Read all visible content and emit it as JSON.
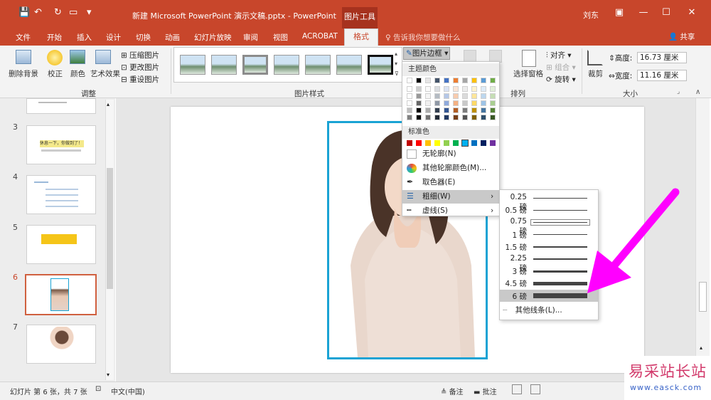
{
  "titlebar": {
    "doc_title": "新建 Microsoft PowerPoint 演示文稿.pptx - PowerPoint",
    "context_tab": "图片工具",
    "user": "刘东"
  },
  "tabs": [
    "文件",
    "开始",
    "插入",
    "设计",
    "切换",
    "动画",
    "幻灯片放映",
    "审阅",
    "视图",
    "ACROBAT",
    "格式"
  ],
  "tell_me": "告诉我你想要做什么",
  "share": "共享",
  "ribbon": {
    "remove_bg": "删除背景",
    "corrections": "校正",
    "color": "颜色",
    "artistic": "艺术效果",
    "compress": "压缩图片",
    "change": "更改图片",
    "reset": "重设图片",
    "group_adjust": "调整",
    "group_styles": "图片样式",
    "picture_border": "图片边框",
    "align": "对齐",
    "group_combine": "组合",
    "rotate": "旋转",
    "selection_pane": "选择窗格",
    "group_arrange": "排列",
    "crop": "裁剪",
    "height_label": "高度:",
    "height_value": "16.73 厘米",
    "width_label": "宽度:",
    "width_value": "11.16 厘米",
    "group_size": "大小"
  },
  "slides": [
    {
      "num": "3",
      "text": "休息一下，你做到了！"
    },
    {
      "num": "4",
      "text": ""
    },
    {
      "num": "5",
      "text": ""
    },
    {
      "num": "6",
      "text": ""
    },
    {
      "num": "7",
      "text": ""
    }
  ],
  "border_menu": {
    "theme_colors": "主题颜色",
    "standard_colors": "标准色",
    "no_outline": "无轮廓(N)",
    "more_colors": "其他轮廓颜色(M)...",
    "eyedropper": "取色器(E)",
    "weight": "粗细(W)",
    "dashes": "虚线(S)"
  },
  "theme_swatch_columns": [
    "#ffffff",
    "#000000",
    "#e7e6e6",
    "#44546a",
    "#4472c4",
    "#ed7d31",
    "#a5a5a5",
    "#ffc000",
    "#5b9bd5",
    "#70ad47"
  ],
  "standard_swatches": [
    "#c00000",
    "#ff0000",
    "#ffc000",
    "#ffff00",
    "#92d050",
    "#00b050",
    "#00b0f0",
    "#0070c0",
    "#002060",
    "#7030a0"
  ],
  "weights": [
    {
      "label": "0.25 磅",
      "value": 0.25
    },
    {
      "label": "0.5 磅",
      "value": 0.5
    },
    {
      "label": "0.75 磅",
      "value": 0.75
    },
    {
      "label": "1 磅",
      "value": 1
    },
    {
      "label": "1.5 磅",
      "value": 1.5
    },
    {
      "label": "2.25 磅",
      "value": 2.25
    },
    {
      "label": "3 磅",
      "value": 3
    },
    {
      "label": "4.5 磅",
      "value": 4.5
    },
    {
      "label": "6 磅",
      "value": 6
    }
  ],
  "more_lines": "其他线条(L)...",
  "status": {
    "slide_info": "幻灯片 第 6 张，共 7 张",
    "language": "中文(中国)",
    "notes": "备注",
    "comments": "批注"
  },
  "watermark": {
    "title": "易采站长站",
    "url": "www.easck.com"
  },
  "colors": {
    "accent": "#c8462b",
    "frame": "#1aa3d4",
    "arrow": "#ff00ff"
  }
}
